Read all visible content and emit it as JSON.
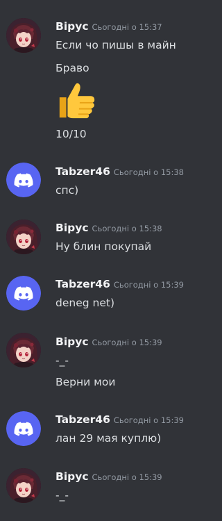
{
  "colors": {
    "background": "#313338",
    "username": "#f2f3f5",
    "timestamp": "#949ba4",
    "text": "#dbdee1",
    "discord_avatar": "#5865f2"
  },
  "messages": [
    {
      "author": "Вірус",
      "avatar": "anime-girl-avatar",
      "time": "Сьогодні о 15:37",
      "lines": [
        "Если чо пишы в майн",
        "Браво",
        "👍",
        "10/10"
      ]
    },
    {
      "author": "Tabzer46",
      "avatar": "discord-logo-avatar",
      "time": "Сьогодні о 15:38",
      "lines": [
        "спс)"
      ]
    },
    {
      "author": "Вірус",
      "avatar": "anime-girl-avatar",
      "time": "Сьогодні о 15:38",
      "lines": [
        "Ну блин покупай"
      ]
    },
    {
      "author": "Tabzer46",
      "avatar": "discord-logo-avatar",
      "time": "Сьогодні о 15:39",
      "lines": [
        "deneg net)"
      ]
    },
    {
      "author": "Вірус",
      "avatar": "anime-girl-avatar",
      "time": "Сьогодні о 15:39",
      "lines": [
        "-_-",
        "Верни мои"
      ]
    },
    {
      "author": "Tabzer46",
      "avatar": "discord-logo-avatar",
      "time": "Сьогодні о 15:39",
      "lines": [
        "лан 29 мая куплю)"
      ]
    },
    {
      "author": "Вірус",
      "avatar": "anime-girl-avatar",
      "time": "Сьогодні о 15:39",
      "lines": [
        "-_-"
      ]
    }
  ]
}
